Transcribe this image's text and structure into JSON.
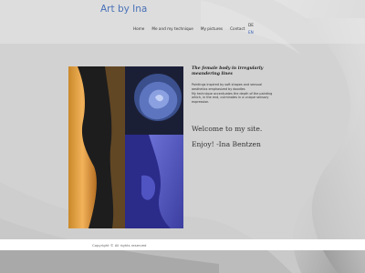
{
  "header": {
    "logo": "Art by Ina",
    "nav": [
      "Home",
      "Me and my technique",
      "My pictures",
      "Contact"
    ],
    "lang": {
      "de": "DE",
      "en": "EN"
    }
  },
  "main": {
    "subtitle": "The female body in irregularly meandering lines",
    "desc": [
      "Paintings inspired by soft shapes and sensual",
      "aesthetics emphasized by doodles",
      "My technique accentuates the depth of the painting",
      "which, in the end, culminates in a unique sensory",
      "expression."
    ],
    "welcome": "Welcome to my site.",
    "enjoy": "Enjoy! -Ina Bentzen"
  },
  "footer": {
    "copyright": "Copyright © All rights reserved"
  },
  "colors": {
    "accent": "#4a72b8",
    "background": "#d6d6d6"
  }
}
